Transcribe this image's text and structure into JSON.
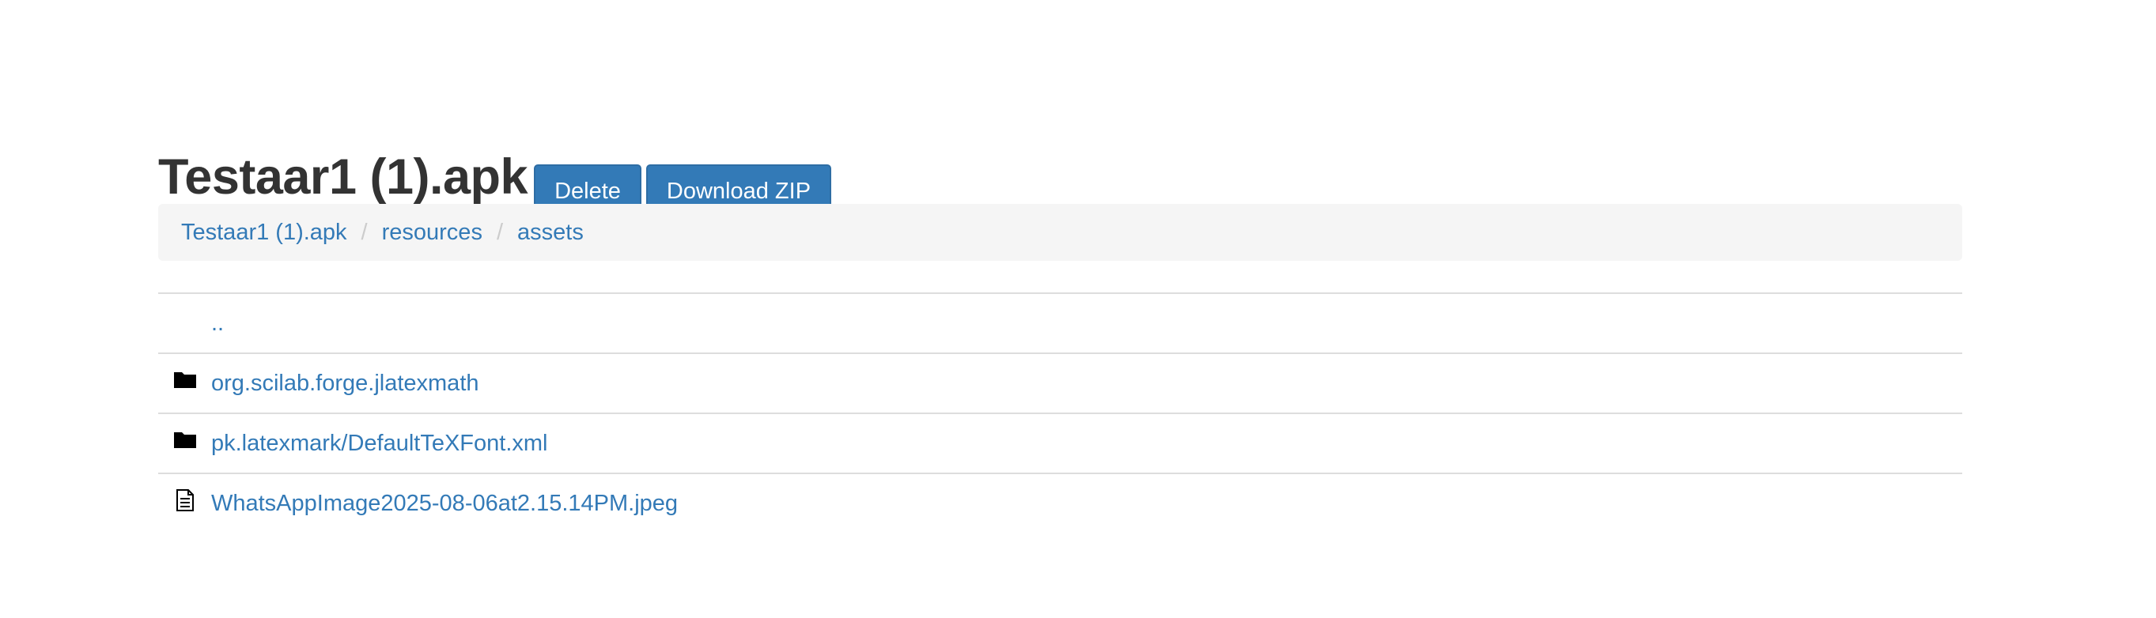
{
  "header": {
    "title": "Testaar1 (1).apk",
    "delete_label": "Delete",
    "download_label": "Download ZIP"
  },
  "breadcrumb": [
    {
      "label": "Testaar1 (1).apk"
    },
    {
      "label": "resources"
    },
    {
      "label": "assets"
    }
  ],
  "breadcrumb_separator": "/",
  "files": [
    {
      "name": "..",
      "icon": "none"
    },
    {
      "name": "org.scilab.forge.jlatexmath",
      "icon": "folder-icon"
    },
    {
      "name": "pk.latexmark/DefaultTeXFont.xml",
      "icon": "folder-icon"
    },
    {
      "name": "WhatsAppImage2025-08-06at2.15.14PM.jpeg",
      "icon": "file-icon"
    }
  ],
  "colors": {
    "link": "#337ab7",
    "button": "#337ab7",
    "breadcrumb_bg": "#f5f5f5"
  }
}
